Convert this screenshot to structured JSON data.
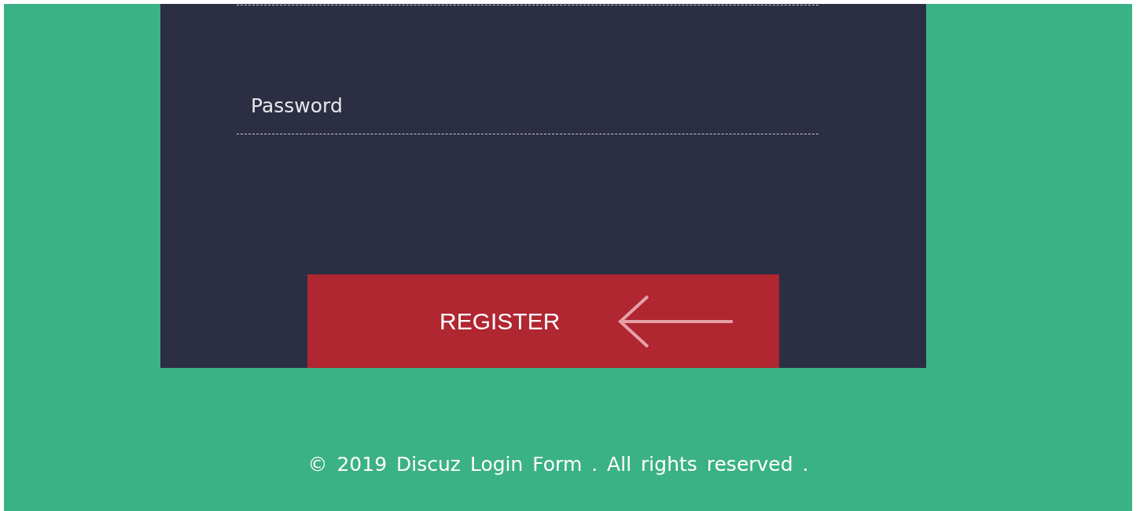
{
  "form": {
    "password_field": {
      "placeholder": "Password"
    },
    "submit_button": {
      "label": "REGISTER"
    }
  },
  "footer": {
    "text": "© 2019 Discuz Login Form . All rights reserved ."
  }
}
